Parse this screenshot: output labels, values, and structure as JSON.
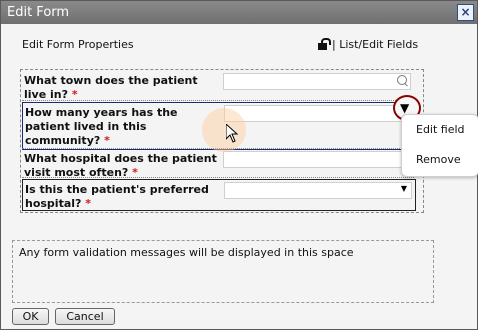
{
  "window": {
    "title": "Edit Form",
    "close_label": "×"
  },
  "header": {
    "properties_link": "Edit Form Properties",
    "list_edit_link": "| List/Edit Fields"
  },
  "fields": [
    {
      "label": "What town does the patient live in?",
      "required_mark": "*"
    },
    {
      "label": "How many years has the patient lived in this community?",
      "required_mark": "*"
    },
    {
      "label": "What hospital does the patient visit most often?",
      "required_mark": "*"
    },
    {
      "label": "Is this the patient's preferred hospital?",
      "required_mark": "*"
    }
  ],
  "context_menu": {
    "edit_label": "Edit field",
    "remove_label": "Remove"
  },
  "validation": {
    "message": "Any form validation messages will be displayed in this space"
  },
  "buttons": {
    "ok": "OK",
    "cancel": "Cancel"
  },
  "icons": {
    "lock": "lock-icon",
    "search": "search-icon",
    "dropdown": "chevron-down-icon"
  },
  "colors": {
    "required": "#d0191a",
    "title_bar": "#7a7a7a",
    "close_button": "#1f3f86"
  }
}
